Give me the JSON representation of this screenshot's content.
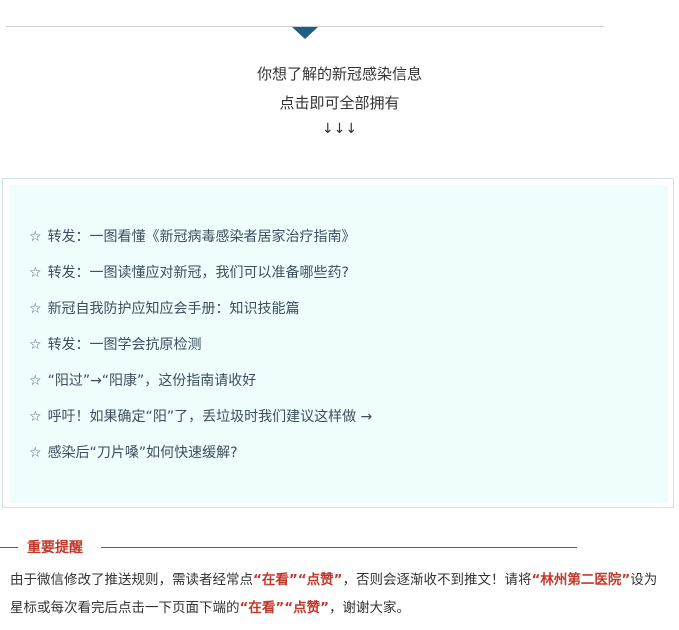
{
  "intro": {
    "line1": "你想了解的新冠感染信息",
    "line2": "点击即可全部拥有",
    "line3": "↓↓↓"
  },
  "links": [
    {
      "star": "☆",
      "label": "转发：一图看懂《新冠病毒感染者居家治疗指南》"
    },
    {
      "star": "☆",
      "label": "转发：一图读懂应对新冠，我们可以准备哪些药?"
    },
    {
      "star": "☆",
      "label": "新冠自我防护应知应会手册：知识技能篇"
    },
    {
      "star": "☆",
      "label": "转发：一图学会抗原检测"
    },
    {
      "star": "☆",
      "label": "“阳过”→“阳康”，这份指南请收好"
    },
    {
      "star": "☆",
      "label": "呼吁！如果确定“阳”了，丢垃圾时我们建议这样做 →"
    },
    {
      "star": "☆",
      "label": "感染后“刀片嗓”如何快速缓解?"
    }
  ],
  "notice": {
    "title": "重要提醒",
    "p1": "由于微信修改了推送规则，需读者经常点",
    "h1": "“在看”“点赞”",
    "p2": "，否则会逐渐收不到推文！请将",
    "h2": "“林州第二医院”",
    "p3": "设为星标或每次看完后点击一下页面下端的",
    "h3": "“在看”“点赞”",
    "p4": "，谢谢大家。"
  },
  "colors": {
    "accent_dark_blue": "#1f5f86",
    "panel_bg": "#effdfd",
    "notice_red": "#c0392b"
  }
}
